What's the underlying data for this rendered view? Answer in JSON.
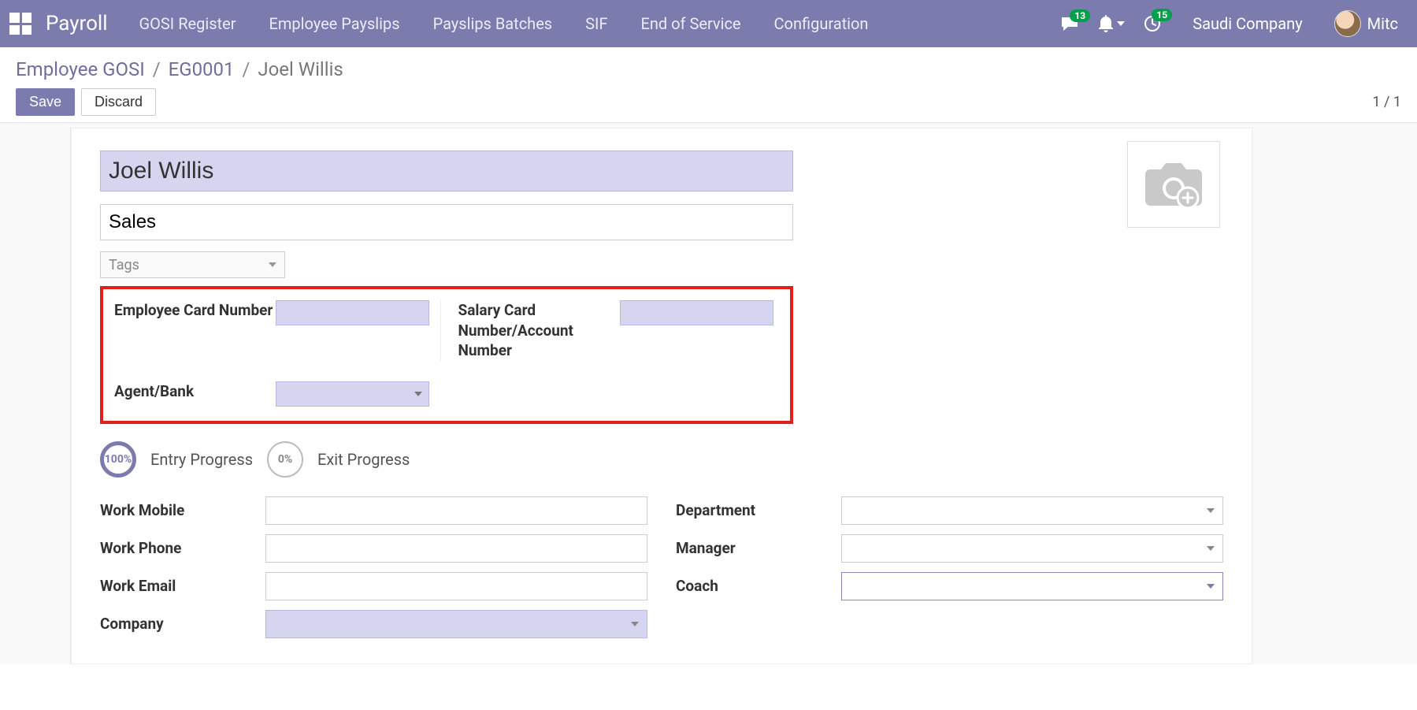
{
  "nav": {
    "brand": "Payroll",
    "links": [
      "GOSI Register",
      "Employee Payslips",
      "Payslips Batches",
      "SIF",
      "End of Service",
      "Configuration"
    ],
    "msg_badge": "13",
    "activity_badge": "15",
    "company": "Saudi Company",
    "user_short": "Mitc"
  },
  "breadcrumb": {
    "root": "Employee GOSI",
    "mid": "EG0001",
    "current": "Joel Willis"
  },
  "buttons": {
    "save": "Save",
    "discard": "Discard"
  },
  "pager": "1 / 1",
  "form": {
    "name": "Joel Willis",
    "department_title": "Sales",
    "tags_placeholder": "Tags",
    "card_section": {
      "emp_card_label": "Employee Card Number",
      "emp_card_value": "",
      "salary_card_label": "Salary Card Number/Account Number",
      "salary_card_value": "",
      "agent_label": "Agent/Bank",
      "agent_value": ""
    },
    "progress": {
      "entry_pct": "100%",
      "entry_label": "Entry Progress",
      "exit_pct": "0%",
      "exit_label": "Exit Progress"
    },
    "left_fields": {
      "work_mobile": {
        "label": "Work Mobile",
        "value": ""
      },
      "work_phone": {
        "label": "Work Phone",
        "value": ""
      },
      "work_email": {
        "label": "Work Email",
        "value": ""
      },
      "company": {
        "label": "Company",
        "value": ""
      }
    },
    "right_fields": {
      "department": {
        "label": "Department",
        "value": ""
      },
      "manager": {
        "label": "Manager",
        "value": ""
      },
      "coach": {
        "label": "Coach",
        "value": ""
      }
    }
  }
}
